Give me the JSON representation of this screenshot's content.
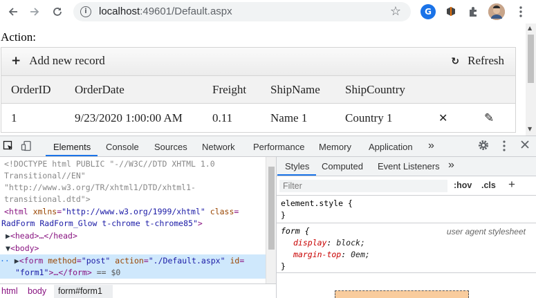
{
  "browser": {
    "url_host": "localhost",
    "url_rest": ":49601/Default.aspx",
    "extensions": [
      {
        "name": "grammarly-icon",
        "glyph": "G",
        "color": "#1a73e8"
      },
      {
        "name": "extension-icon-2",
        "glyph": "",
        "color": "#555555"
      }
    ]
  },
  "page": {
    "action_label": "Action:",
    "add_new_record": "Add new record",
    "refresh": "Refresh",
    "columns": [
      "OrderID",
      "OrderDate",
      "Freight",
      "ShipName",
      "ShipCountry"
    ],
    "rows": [
      {
        "OrderID": "1",
        "OrderDate": "9/23/2020 1:00:00 AM",
        "Freight": "0.11",
        "ShipName": "Name 1",
        "ShipCountry": "Country 1"
      }
    ]
  },
  "devtools": {
    "tabs": [
      "Elements",
      "Console",
      "Sources",
      "Network",
      "Performance",
      "Memory",
      "Application"
    ],
    "more": "»",
    "elements": {
      "doctype_1": "<!DOCTYPE html PUBLIC \"-//W3C//DTD XHTML 1.0",
      "doctype_2": "Transitional//EN\"",
      "doctype_3": "\"http://www.w3.org/TR/xhtml1/DTD/xhtml1-",
      "doctype_4": "transitional.dtd\">",
      "html_tag": "<html",
      "html_attr1": "xmlns",
      "html_val1": "\"http://www.w3.org/1999/xhtml\"",
      "html_attr2": "class",
      "html_val2_a": "RadForm RadForm_Glow t-chrome t-chrome85\"",
      "html_close": ">",
      "head": "<head>…</head>",
      "body": "<body>",
      "form_open": "<form",
      "form_attr1": "method",
      "form_val1": "\"post\"",
      "form_attr2": "action",
      "form_val2": "\"./Default.aspx\"",
      "form_attr3": "id",
      "form_val3": "\"form1\"",
      "form_end": ">…</form>",
      "form_eq": "== $0"
    },
    "breadcrumbs": [
      "html",
      "body",
      "form#form1"
    ],
    "styles": {
      "tabs": [
        "Styles",
        "Computed",
        "Event Listeners"
      ],
      "filter_placeholder": "Filter",
      "hov": ":hov",
      "cls": ".cls",
      "element_style": "element.style {",
      "close_brace": "}",
      "form_selector": "form {",
      "ua_label": "user agent stylesheet",
      "props": [
        {
          "name": "display",
          "value": "block;"
        },
        {
          "name": "margin-top",
          "value": "0em;"
        }
      ]
    }
  }
}
